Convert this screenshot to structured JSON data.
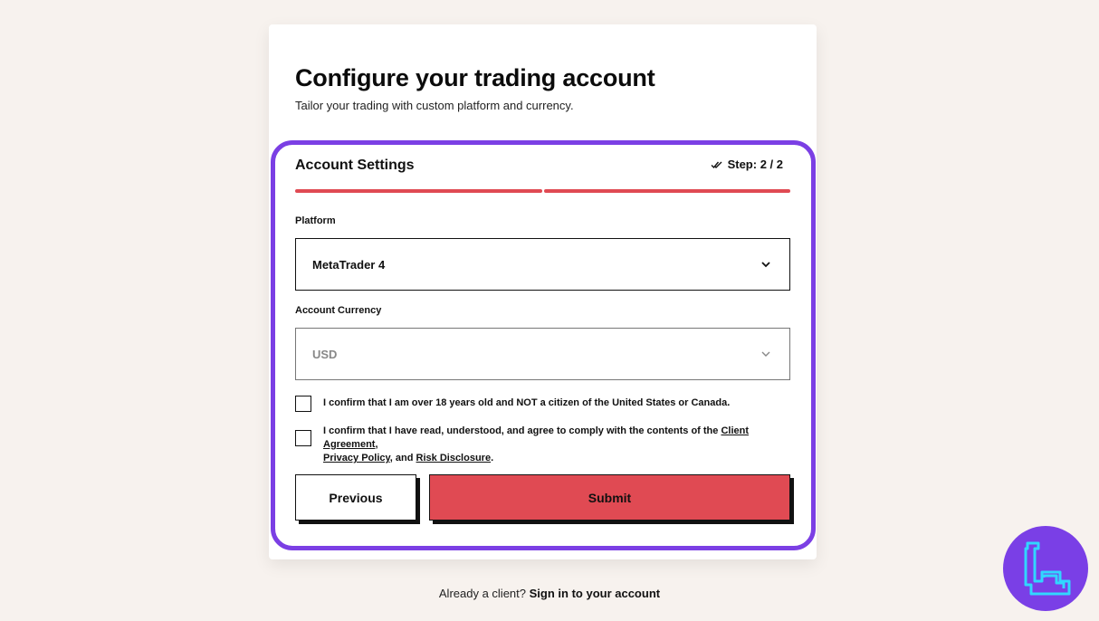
{
  "header": {
    "title": "Configure your trading account",
    "subtitle": "Tailor your trading with custom platform and currency."
  },
  "form": {
    "section_title": "Account Settings",
    "step_label": "Step: 2 / 2",
    "progress": {
      "current_step": 2,
      "total_steps": 2
    },
    "platform": {
      "label": "Platform",
      "value": "MetaTrader 4"
    },
    "currency": {
      "label": "Account Currency",
      "value": "USD"
    },
    "confirm_age": {
      "text": "I confirm that I am over 18 years old and NOT a citizen of the United States or Canada.",
      "checked": false
    },
    "confirm_terms": {
      "text_before": "I confirm that I have read, understood, and agree to comply with the contents of the ",
      "link_client_agreement": "Client Agreement",
      "sep1": ",",
      "link_privacy_policy": "Privacy Policy",
      "sep2": ", and ",
      "link_risk_disclosure": "Risk Disclosure",
      "text_after": ".",
      "checked": false
    },
    "previous_label": "Previous",
    "submit_label": "Submit"
  },
  "footer": {
    "prompt": "Already a client?",
    "link": "Sign in to your account"
  },
  "colors": {
    "background": "#f7f2ee",
    "accent_red": "#e04a53",
    "highlight_purple": "#7b3fe4",
    "badge_cyan": "#31d6ff"
  },
  "icons": {
    "step": "double-check-icon",
    "dropdown": "chevron-down-icon",
    "badge": "tradingfinder-logo-icon"
  }
}
